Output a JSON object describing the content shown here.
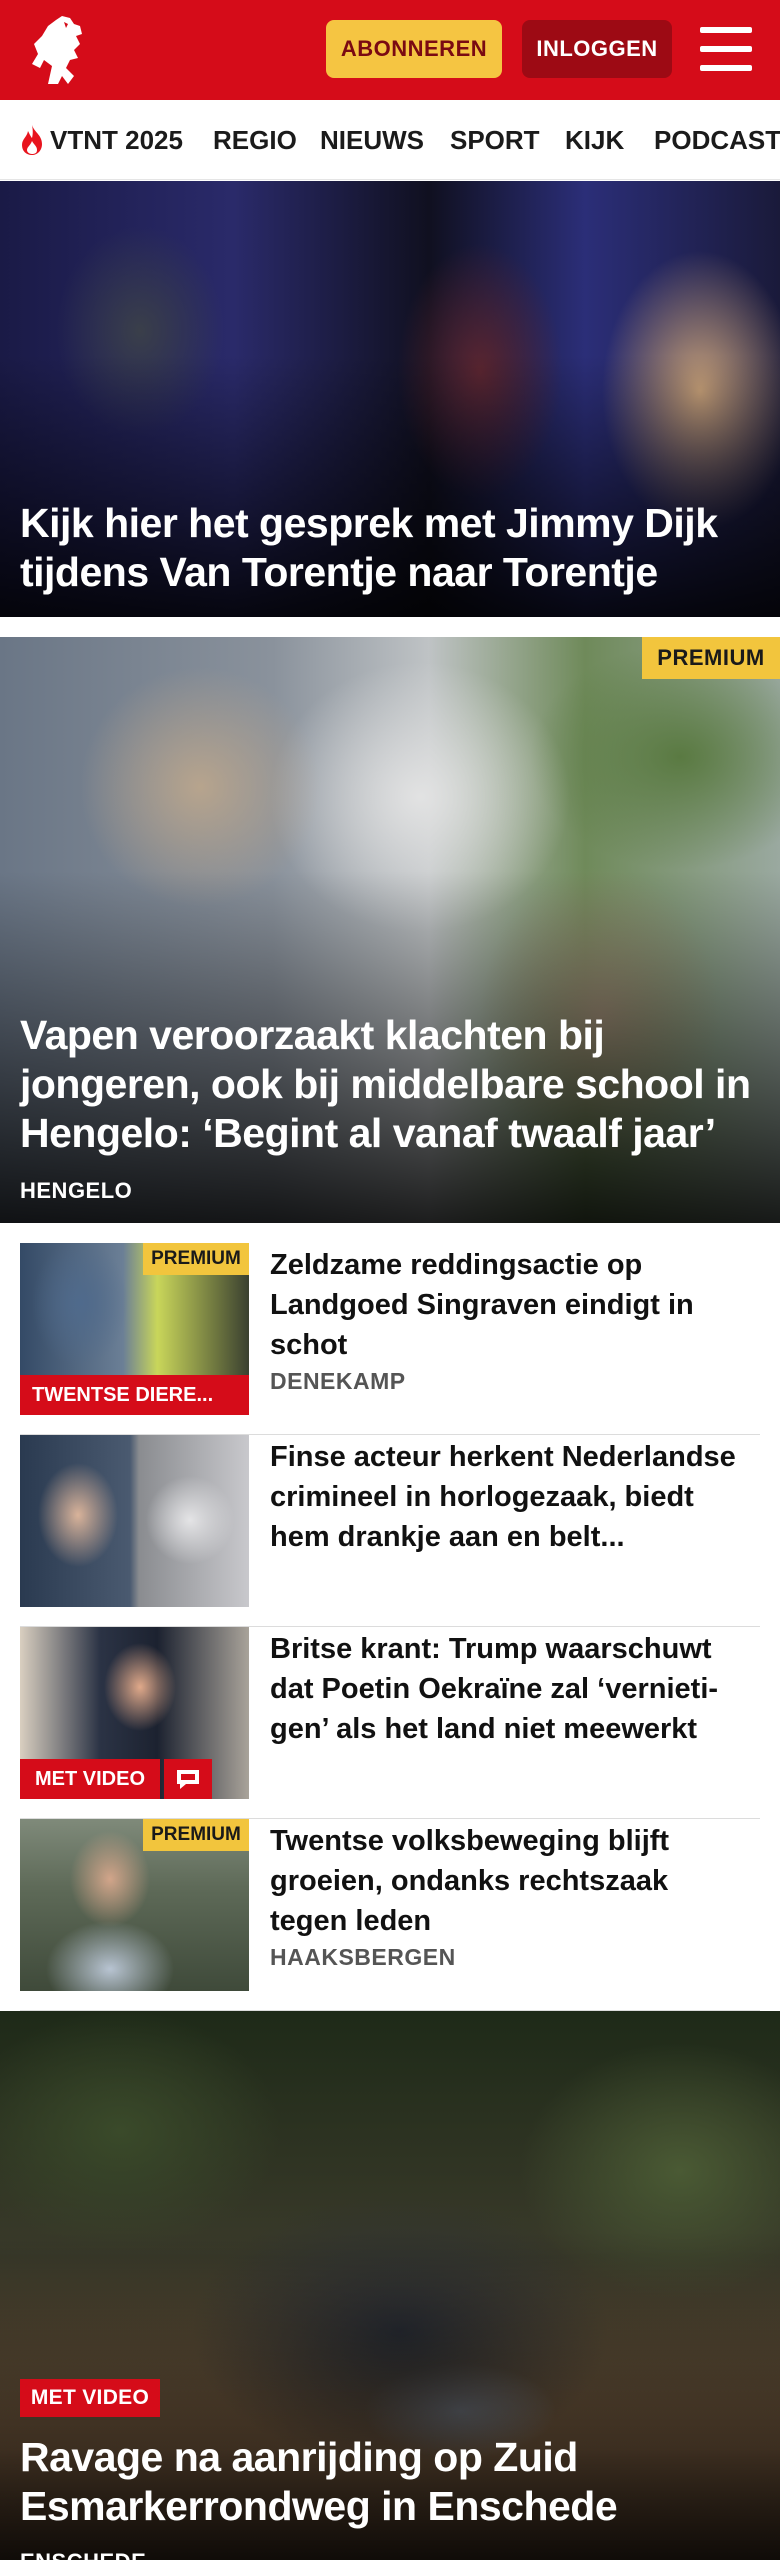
{
  "header": {
    "subscribe_label": "ABONNEREN",
    "login_label": "INLOGGEN",
    "brand_color": "#d50c19"
  },
  "nav": {
    "items": [
      {
        "label": "VTNT 2025",
        "icon": "flame-icon"
      },
      {
        "label": "REGIO"
      },
      {
        "label": "NIEUWS"
      },
      {
        "label": "SPORT"
      },
      {
        "label": "KIJK"
      },
      {
        "label": "PODCAST"
      }
    ]
  },
  "hero1": {
    "title": "Kijk hier het gesprek met Jimmy Dijk tijdens Van Torentje naar Torentje"
  },
  "hero2": {
    "badge": "PREMIUM",
    "title": "Vapen veroorzaakt klachten bij jongeren, ook bij middelbare school in Hengelo: ‘Begint al vanaf twaalf jaar’",
    "location": "HENGELO"
  },
  "articles": [
    {
      "badge": "PREMIUM",
      "category": "TWENTSE DIERE...",
      "title": "Zeldzame reddingsactie op Landgoed Singraven eindigt in schot",
      "location": "DENEKAMP"
    },
    {
      "title": "Finse acteur herkent Nederland­se crimineel in horlogezaak, biedt hem drankje aan en belt..."
    },
    {
      "video_label": "MET VIDEO",
      "title": "Britse krant: Trump waarschuwt dat Poetin Oekraïne zal ‘vernieti­gen’ als het land niet meewerkt"
    },
    {
      "badge": "PREMIUM",
      "title": "Twentse volksbeweging blijft groeien, ondanks rechtszaak tegen leden",
      "location": "HAAKSBERGEN"
    }
  ],
  "hero3": {
    "video_label": "MET VIDEO",
    "title": "Ravage na aanrijding op Zuid Esmarkerrondweg in Enschede",
    "location": "ENSCHEDE"
  }
}
